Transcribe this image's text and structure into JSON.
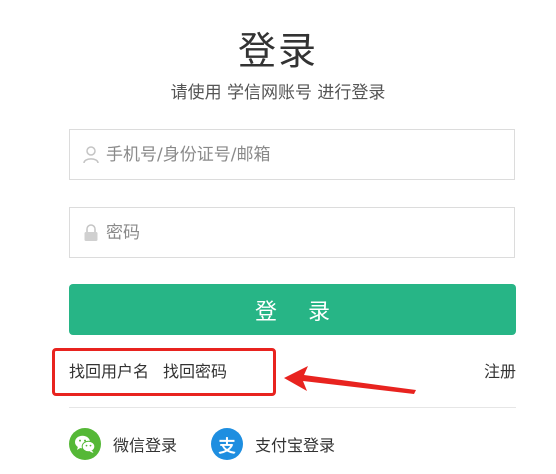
{
  "header": {
    "title": "登录",
    "subtitle": "请使用 学信网账号 进行登录"
  },
  "form": {
    "username_placeholder": "手机号/身份证号/邮箱",
    "password_placeholder": "密码",
    "login_button": "登 录"
  },
  "links": {
    "find_username": "找回用户名",
    "find_password": "找回密码",
    "register": "注册"
  },
  "social": {
    "wechat_label": "微信登录",
    "alipay_label": "支付宝登录",
    "alipay_glyph": "支"
  },
  "annotation": {
    "color": "#e8231f"
  },
  "colors": {
    "primary": "#27b586",
    "wechat": "#55b837",
    "alipay": "#1e8ee0"
  }
}
